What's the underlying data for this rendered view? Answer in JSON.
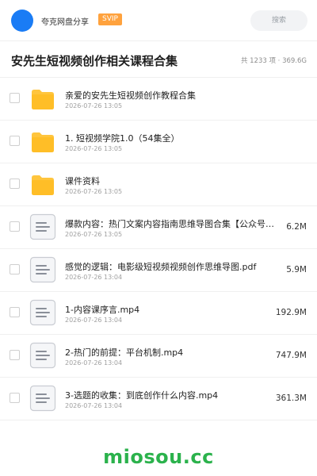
{
  "header": {
    "brand": "夸克网盘分享",
    "badge": "SVIP",
    "search_placeholder": "搜索"
  },
  "folder": {
    "title": "安先生短视频创作相关课程合集",
    "stats": "共 1233 项 · 369.6G"
  },
  "items": [
    {
      "type": "folder",
      "name": "亲爱的安先生短视频创作教程合集",
      "date": "2026-07-26 13:05",
      "size": ""
    },
    {
      "type": "folder",
      "name": "1. 短视频学院1.0（54集全）",
      "date": "2026-07-26 13:05",
      "size": ""
    },
    {
      "type": "folder",
      "name": "课件资料",
      "date": "2026-07-26 13:05",
      "size": ""
    },
    {
      "type": "file",
      "name": "爆款内容：热门文案内容指南思维导图合集【公众号：密…",
      "date": "2026-07-26 13:05",
      "size": "6.2M"
    },
    {
      "type": "file",
      "name": "感觉的逻辑：电影级短视频视频创作思维导图.pdf",
      "date": "2026-07-26 13:04",
      "size": "5.9M"
    },
    {
      "type": "file",
      "name": "1-内容课序言.mp4",
      "date": "2026-07-26 13:04",
      "size": "192.9M"
    },
    {
      "type": "file",
      "name": "2-热门的前提：平台机制.mp4",
      "date": "2026-07-26 13:04",
      "size": "747.9M"
    },
    {
      "type": "file",
      "name": "3-选题的收集：到底创作什么内容.mp4",
      "date": "2026-07-26 13:04",
      "size": "361.3M"
    }
  ],
  "watermark": "miosou.cc",
  "colors": {
    "avatar": "#1a7cf5",
    "badge": "#ffa23d",
    "folder": "#ffc53d",
    "watermark": "#2bb24c"
  }
}
